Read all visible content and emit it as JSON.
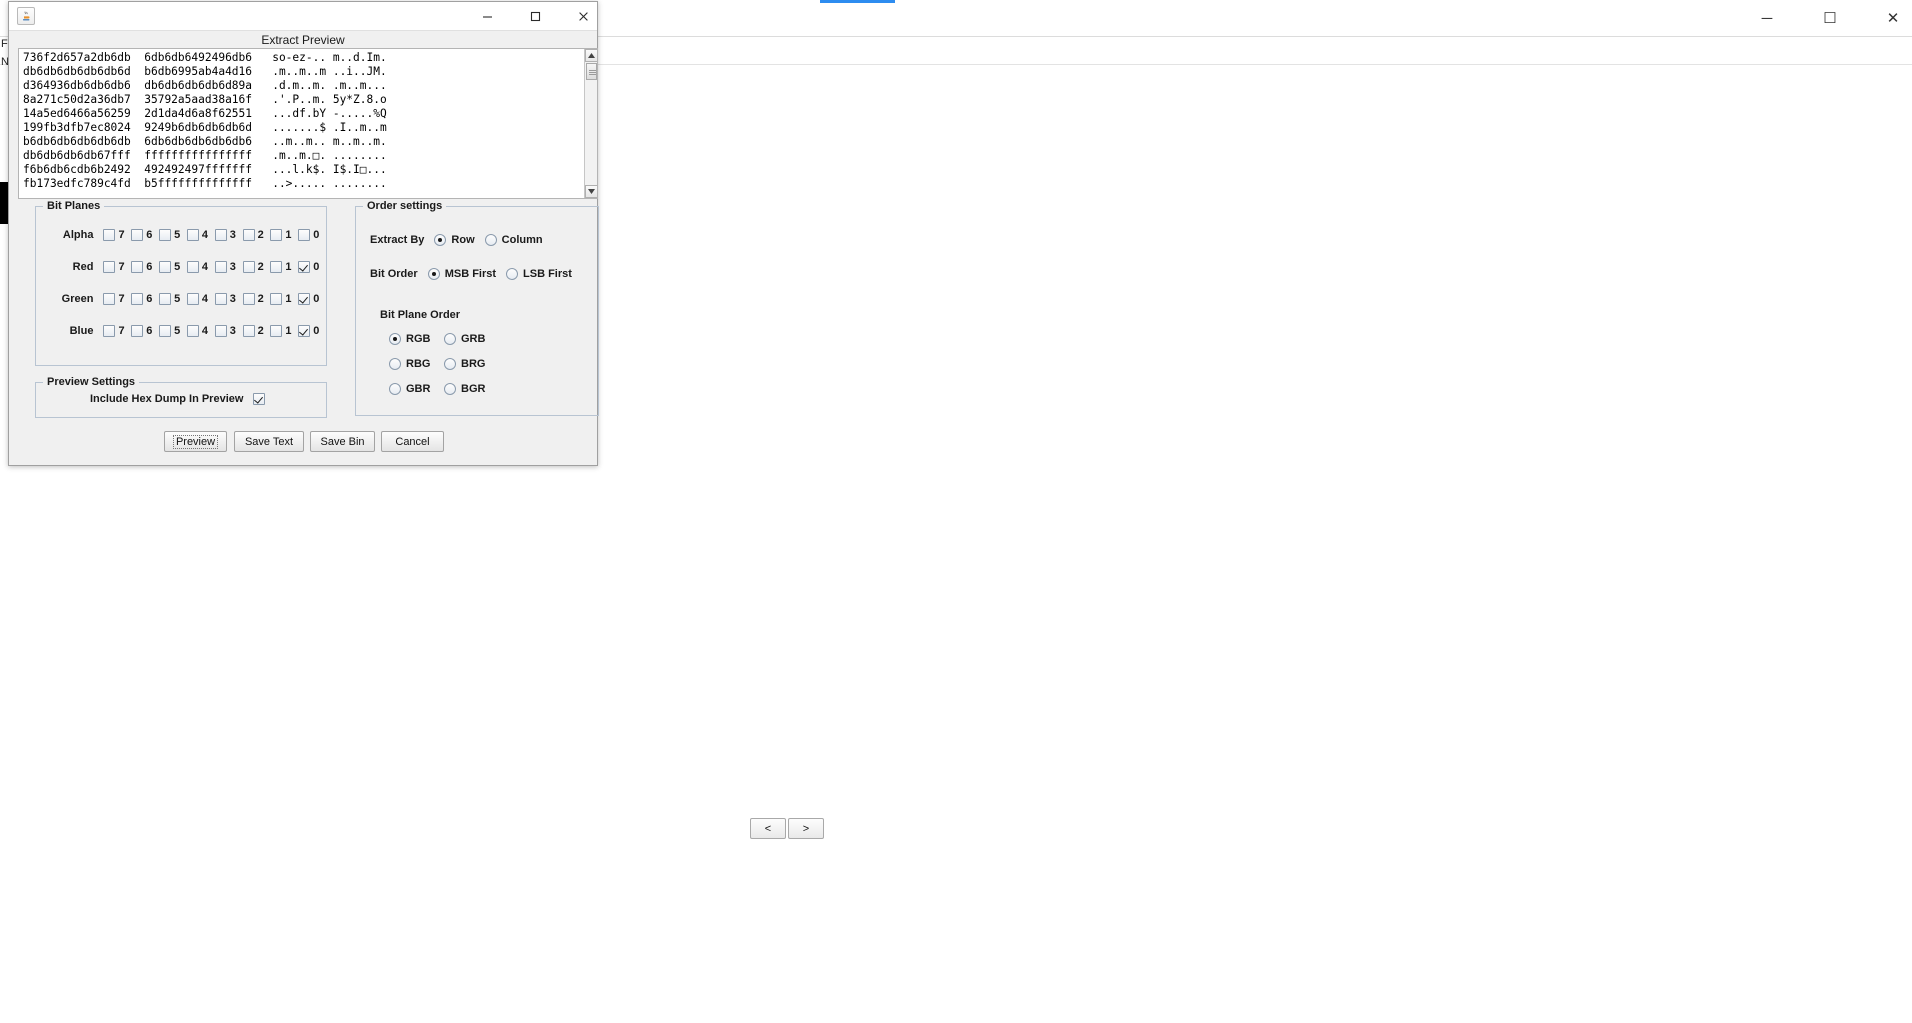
{
  "background_window": {
    "left_edge_letters": [
      "F",
      "N"
    ],
    "window_controls": {
      "minimize": "─",
      "maximize": "☐",
      "close": "✕"
    },
    "nav": {
      "prev_label": "<",
      "next_label": ">"
    }
  },
  "dialog": {
    "title_icon": "java-coffee-icon",
    "heading": "Extract Preview",
    "window_controls": {
      "minimize": "─",
      "maximize": "☐",
      "close": "✕"
    },
    "hex_dump": "736f2d657a2db6db  6db6db6492496db6   so-ez-.. m..d.Im.\ndb6db6db6db6db6d  b6db6995ab4a4d16   .m..m..m ..i..JM.\nd364936db6db6db6  db6db6db6db6d89a   .d.m..m. .m..m...\n8a271c50d2a36db7  35792a5aad38a16f   .'.P..m. 5y*Z.8.o\n14a5ed6466a56259  2d1da4d6a8f62551   ...df.bY -.....%Q\n199fb3dfb7ec8024  9249b6db6db6db6d   .......$ .I..m..m\nb6db6db6db6db6db  6db6db6db6db6db6   ..m..m.. m..m..m.\ndb6db6db6db67fff  ffffffffffffffff   .m..m.□. ........\nf6b6db6cdb6b2492  492492497fffffff   ...l.k$. I$.I□...\nfb173edfc789c4fd  b5ffffffffffffff   ..>..... ........",
    "scrollbar": {
      "up_arrow": "▲",
      "down_arrow": "▼"
    },
    "bit_planes": {
      "group_title": "Bit Planes",
      "bit_labels": [
        "7",
        "6",
        "5",
        "4",
        "3",
        "2",
        "1",
        "0"
      ],
      "channels": [
        {
          "name": "Alpha",
          "checked": [
            false,
            false,
            false,
            false,
            false,
            false,
            false,
            false
          ]
        },
        {
          "name": "Red",
          "checked": [
            false,
            false,
            false,
            false,
            false,
            false,
            false,
            true
          ]
        },
        {
          "name": "Green",
          "checked": [
            false,
            false,
            false,
            false,
            false,
            false,
            false,
            true
          ]
        },
        {
          "name": "Blue",
          "checked": [
            false,
            false,
            false,
            false,
            false,
            false,
            false,
            true
          ]
        }
      ]
    },
    "order_settings": {
      "group_title": "Order settings",
      "extract_by": {
        "label": "Extract By",
        "options": [
          "Row",
          "Column"
        ],
        "selected": "Row"
      },
      "bit_order": {
        "label": "Bit Order",
        "options": [
          "MSB First",
          "LSB First"
        ],
        "selected": "MSB First"
      },
      "bit_plane_order": {
        "label": "Bit Plane Order",
        "options": [
          "RGB",
          "GRB",
          "RBG",
          "BRG",
          "GBR",
          "BGR"
        ],
        "selected": "RGB"
      }
    },
    "preview_settings": {
      "group_title": "Preview Settings",
      "include_hex_dump": {
        "label": "Include Hex Dump In Preview",
        "checked": true
      }
    },
    "buttons": {
      "preview": "Preview",
      "save_text": "Save Text",
      "save_bin": "Save Bin",
      "cancel": "Cancel"
    }
  }
}
